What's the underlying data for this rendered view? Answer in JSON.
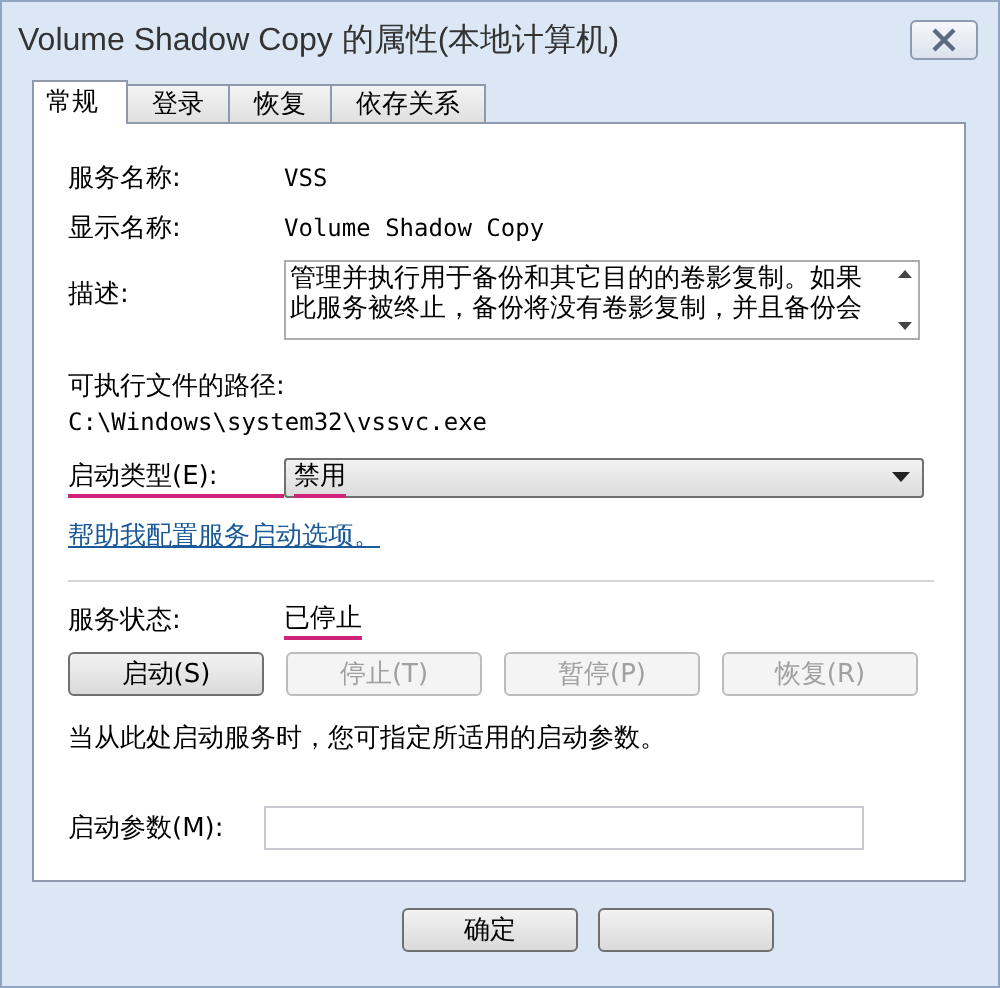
{
  "window": {
    "title": "Volume Shadow Copy 的属性(本地计算机)"
  },
  "tabs": [
    {
      "label": "常规",
      "selected": true
    },
    {
      "label": "登录",
      "selected": false
    },
    {
      "label": "恢复",
      "selected": false
    },
    {
      "label": "依存关系",
      "selected": false
    }
  ],
  "fields": [
    {
      "label": "服务名称:",
      "value": "VSS"
    },
    {
      "label": "显示名称:",
      "value": "Volume Shadow Copy"
    }
  ],
  "description": {
    "label": "描述:",
    "text": "管理并执行用于备份和其它目的的卷影复制。如果此服务被终止，备份将没有卷影复制，并且备份会"
  },
  "executable": {
    "label": "可执行文件的路径:",
    "path": "C:\\Windows\\system32\\vssvc.exe"
  },
  "startup_type": {
    "label": "启动类型(E):",
    "value": "禁用",
    "highlighted": true
  },
  "help_link": "帮助我配置服务启动选项。",
  "status": {
    "label": "服务状态:",
    "value": "已停止",
    "highlighted": true
  },
  "service_buttons": [
    {
      "label": "启动(S)",
      "disabled": false
    },
    {
      "label": "停止(T)",
      "disabled": true
    },
    {
      "label": "暂停(P)",
      "disabled": true
    },
    {
      "label": "恢复(R)",
      "disabled": true
    }
  ],
  "hint": "当从此处启动服务时，您可指定所适用的启动参数。",
  "start_params": {
    "label": "启动参数(M):"
  },
  "dialog_buttons": [
    "确定"
  ]
}
